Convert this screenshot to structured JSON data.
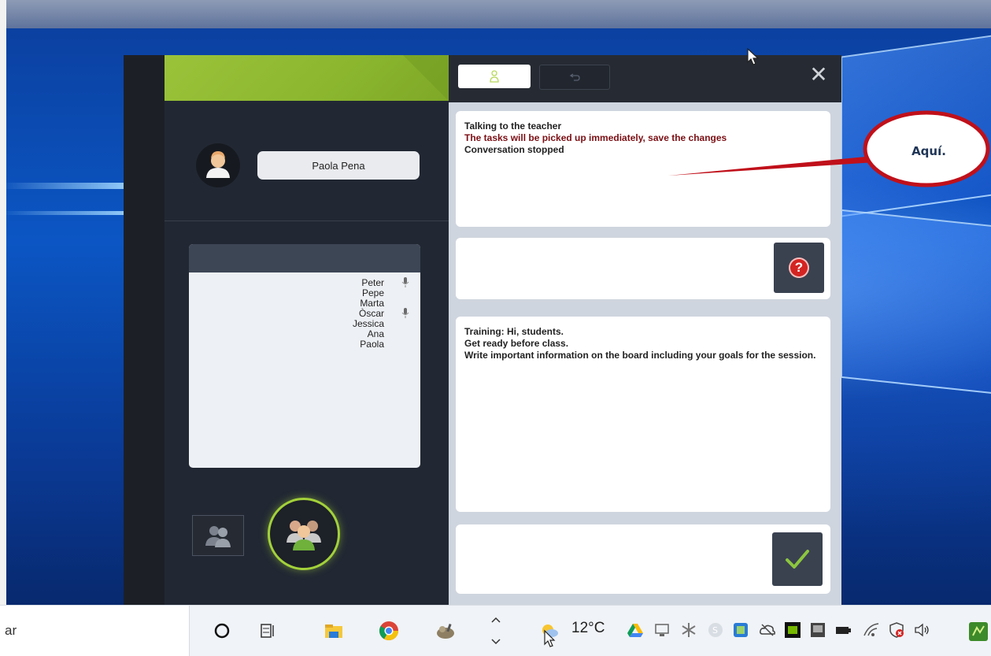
{
  "window": {
    "tabs": [
      {
        "name": "people",
        "icon": "person-icon",
        "active": true
      },
      {
        "name": "undo",
        "icon": "undo-icon",
        "active": false
      }
    ],
    "close_glyph": "✕"
  },
  "profile": {
    "avatar_icon": "user-avatar-icon",
    "name": "Paola Pena"
  },
  "participants": [
    {
      "name": "Peter",
      "mic": true
    },
    {
      "name": "Pepe",
      "mic": false
    },
    {
      "name": "Marta",
      "mic": false
    },
    {
      "name": "Òscar",
      "mic": true
    },
    {
      "name": "Jessica",
      "mic": false
    },
    {
      "name": "Ana",
      "mic": false
    },
    {
      "name": "Paola",
      "mic": false
    }
  ],
  "status_messages": {
    "line1": "Talking to the teacher",
    "line2": "The tasks will be picked up immediately, save the changes",
    "line3": "Conversation stopped"
  },
  "help_button": {
    "glyph": "?"
  },
  "training_message": {
    "line1": "Training: Hi, students.",
    "line2": "Get ready before class.",
    "line3": "Write important information on the board including your goals for the session."
  },
  "annotation": {
    "text": "Aquí.",
    "color": "#c0101a"
  },
  "taskbar": {
    "search_text": "ar",
    "weather": {
      "temp": "12°C"
    }
  },
  "colors": {
    "accent_green": "#a3d13a",
    "dark_bg": "#262b33",
    "message_red": "#7b0f14"
  }
}
